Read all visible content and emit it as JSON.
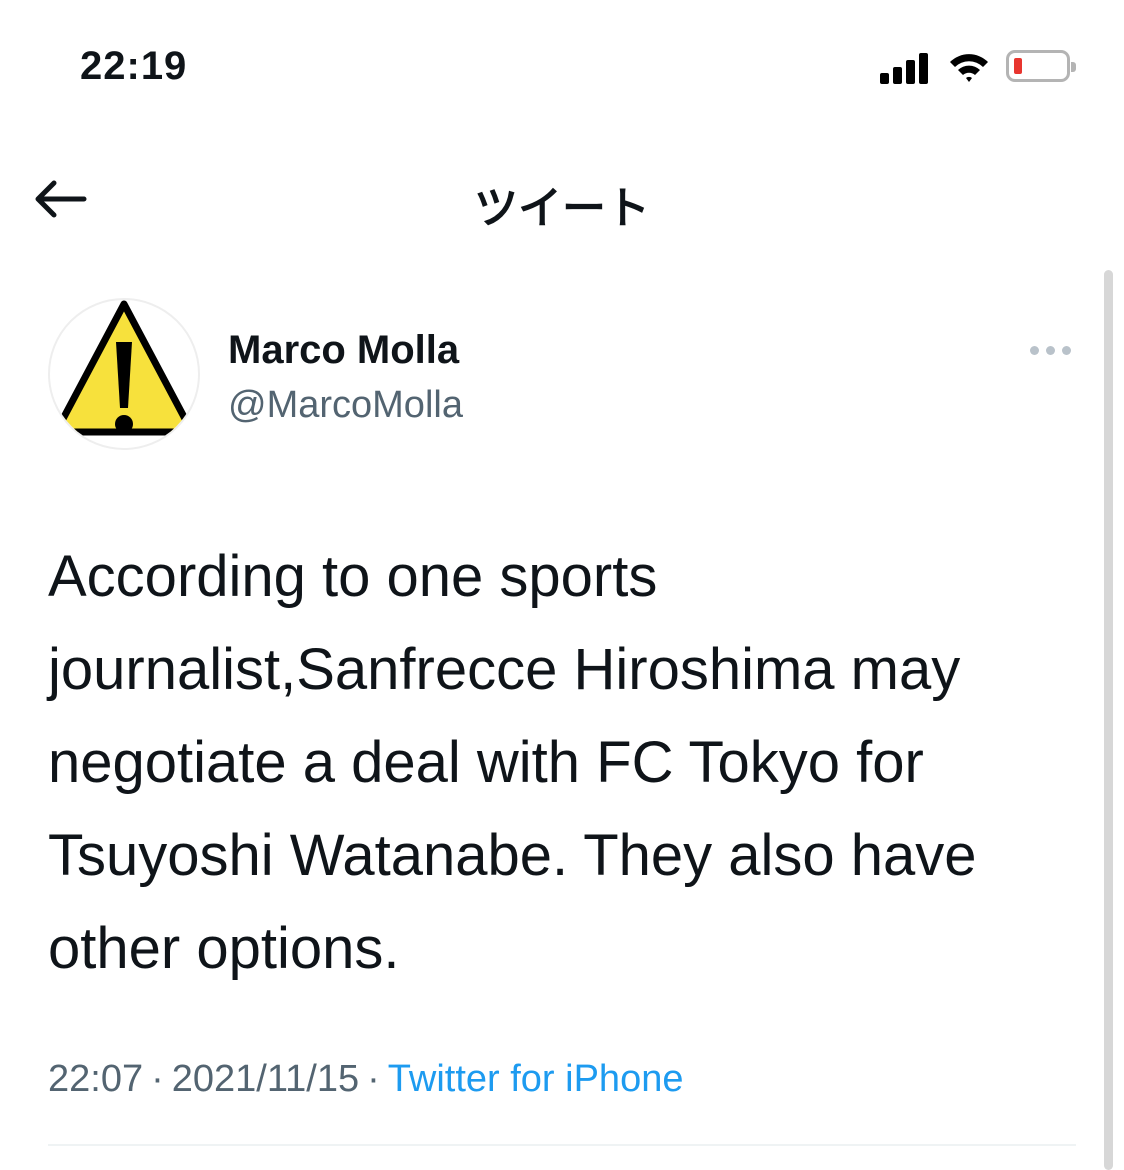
{
  "status_bar": {
    "time": "22:19",
    "signal_icon": "cellular-signal-icon",
    "wifi_icon": "wifi-icon",
    "battery_icon": "battery-low-icon",
    "battery_color": "#e8352f"
  },
  "header": {
    "back_icon": "back-arrow-icon",
    "title": "ツイート"
  },
  "tweet": {
    "avatar_icon": "warning-sign-icon",
    "display_name": "Marco Molla",
    "handle": "@MarcoMolla",
    "more_icon": "more-options-icon",
    "text": "According to one sports journalist,Sanfrecce Hiroshima may negotiate a deal with FC Tokyo for Tsuyoshi Watanabe. They also have other options.",
    "time": "22:07",
    "separator": "·",
    "date": "2021/11/15",
    "source": "Twitter for iPhone"
  },
  "colors": {
    "link": "#1d9bf0",
    "secondary_text": "#536471",
    "avatar_yellow": "#f7e13c"
  }
}
